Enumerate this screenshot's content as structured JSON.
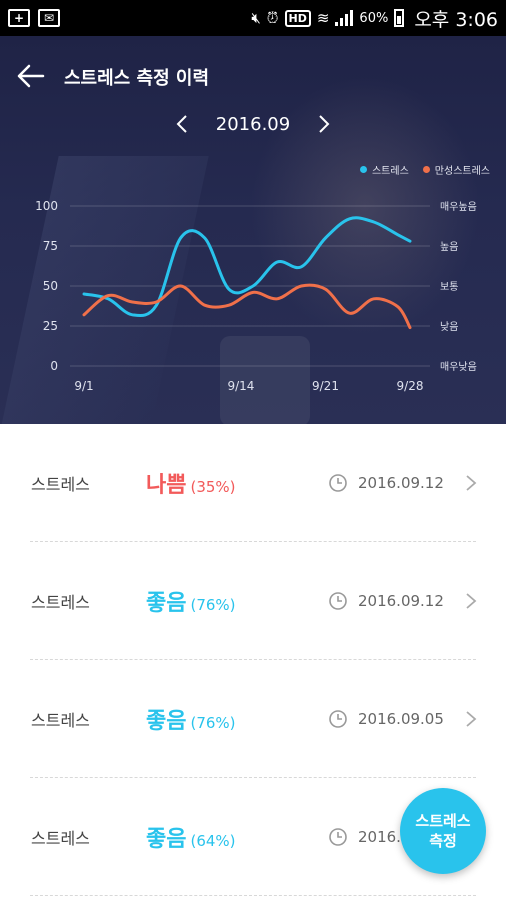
{
  "status_bar": {
    "battery": "60%",
    "time": "오후 3:06",
    "left_icons": [
      "add-icon",
      "mail-icon"
    ],
    "right_icons": [
      "mute-icon",
      "alarm-icon",
      "hd-icon",
      "wifi-icon",
      "signal-icon",
      "battery-icon"
    ],
    "hd_label": "HD"
  },
  "header": {
    "title": "스트레스 측정 이력",
    "month": "2016.09"
  },
  "legend": [
    {
      "label": "스트레스",
      "color": "#29c3ec"
    },
    {
      "label": "만성스트레스",
      "color": "#f0704a"
    }
  ],
  "chart_data": {
    "type": "line",
    "x": [
      1,
      3,
      5,
      7,
      9,
      11,
      13,
      15,
      17,
      19,
      21,
      23,
      25,
      27,
      28
    ],
    "x_ticks": [
      "9/1",
      "9/14",
      "9/21",
      "9/28"
    ],
    "x_tick_values": [
      1,
      14,
      21,
      28
    ],
    "y_ticks_left": [
      "0",
      "25",
      "50",
      "75",
      "100"
    ],
    "y_ticks_right": [
      "매우낮음",
      "낮음",
      "보통",
      "높음",
      "매우높음"
    ],
    "ylim": [
      0,
      100
    ],
    "grid": true,
    "series": [
      {
        "name": "스트레스",
        "color": "#29c3ec",
        "values": [
          45,
          42,
          32,
          38,
          80,
          80,
          48,
          50,
          65,
          62,
          80,
          92,
          90,
          82,
          78
        ]
      },
      {
        "name": "만성스트레스",
        "color": "#f0704a",
        "values": [
          32,
          44,
          40,
          40,
          50,
          38,
          38,
          46,
          42,
          50,
          48,
          33,
          42,
          37,
          24
        ]
      }
    ]
  },
  "rows": [
    {
      "label": "스트레스",
      "grade": "나쁨",
      "pct": "(35%)",
      "color": "#f25a5a",
      "date": "2016.09.12"
    },
    {
      "label": "스트레스",
      "grade": "좋음",
      "pct": "(76%)",
      "color": "#29c3ec",
      "date": "2016.09.12"
    },
    {
      "label": "스트레스",
      "grade": "좋음",
      "pct": "(76%)",
      "color": "#29c3ec",
      "date": "2016.09.05"
    },
    {
      "label": "스트레스",
      "grade": "좋음",
      "pct": "(64%)",
      "color": "#29c3ec",
      "date": "2016.09.05"
    }
  ],
  "fab": {
    "line1": "스트레스",
    "line2": "측정"
  }
}
